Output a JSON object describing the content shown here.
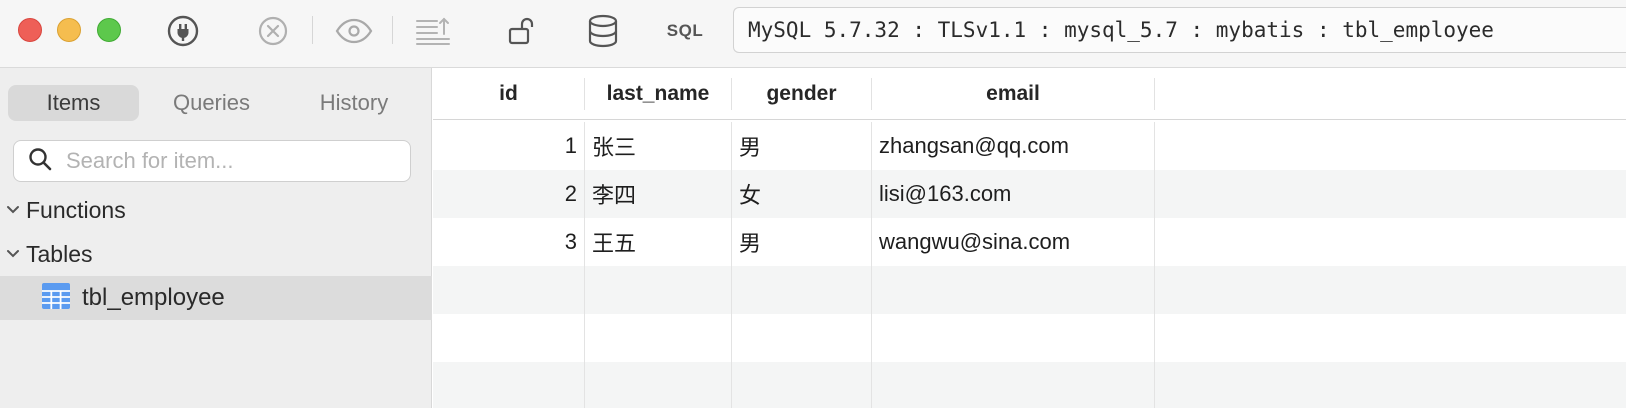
{
  "toolbar": {
    "sql_label": "SQL",
    "connection_info": "MySQL 5.7.32 : TLSv1.1 : mysql_5.7 : mybatis : tbl_employee"
  },
  "sidebar": {
    "tabs": [
      {
        "label": "Items",
        "active": true
      },
      {
        "label": "Queries",
        "active": false
      },
      {
        "label": "History",
        "active": false
      }
    ],
    "search": {
      "placeholder": "Search for item..."
    },
    "groups": [
      {
        "label": "Functions"
      },
      {
        "label": "Tables"
      }
    ],
    "tables": [
      {
        "label": "tbl_employee",
        "selected": true
      }
    ]
  },
  "grid": {
    "columns": [
      "id",
      "last_name",
      "gender",
      "email"
    ],
    "rows": [
      {
        "id": "1",
        "last_name": "张三",
        "gender": "男",
        "email": "zhangsan@qq.com"
      },
      {
        "id": "2",
        "last_name": "李四",
        "gender": "女",
        "email": "lisi@163.com"
      },
      {
        "id": "3",
        "last_name": "王五",
        "gender": "男",
        "email": "wangwu@sina.com"
      }
    ]
  },
  "colors": {
    "selection": "#dcdcdc",
    "table_icon": "#5b9bf0",
    "close": "#ee5f57",
    "minimize": "#f5bd4f",
    "maximize": "#5dc84c"
  }
}
